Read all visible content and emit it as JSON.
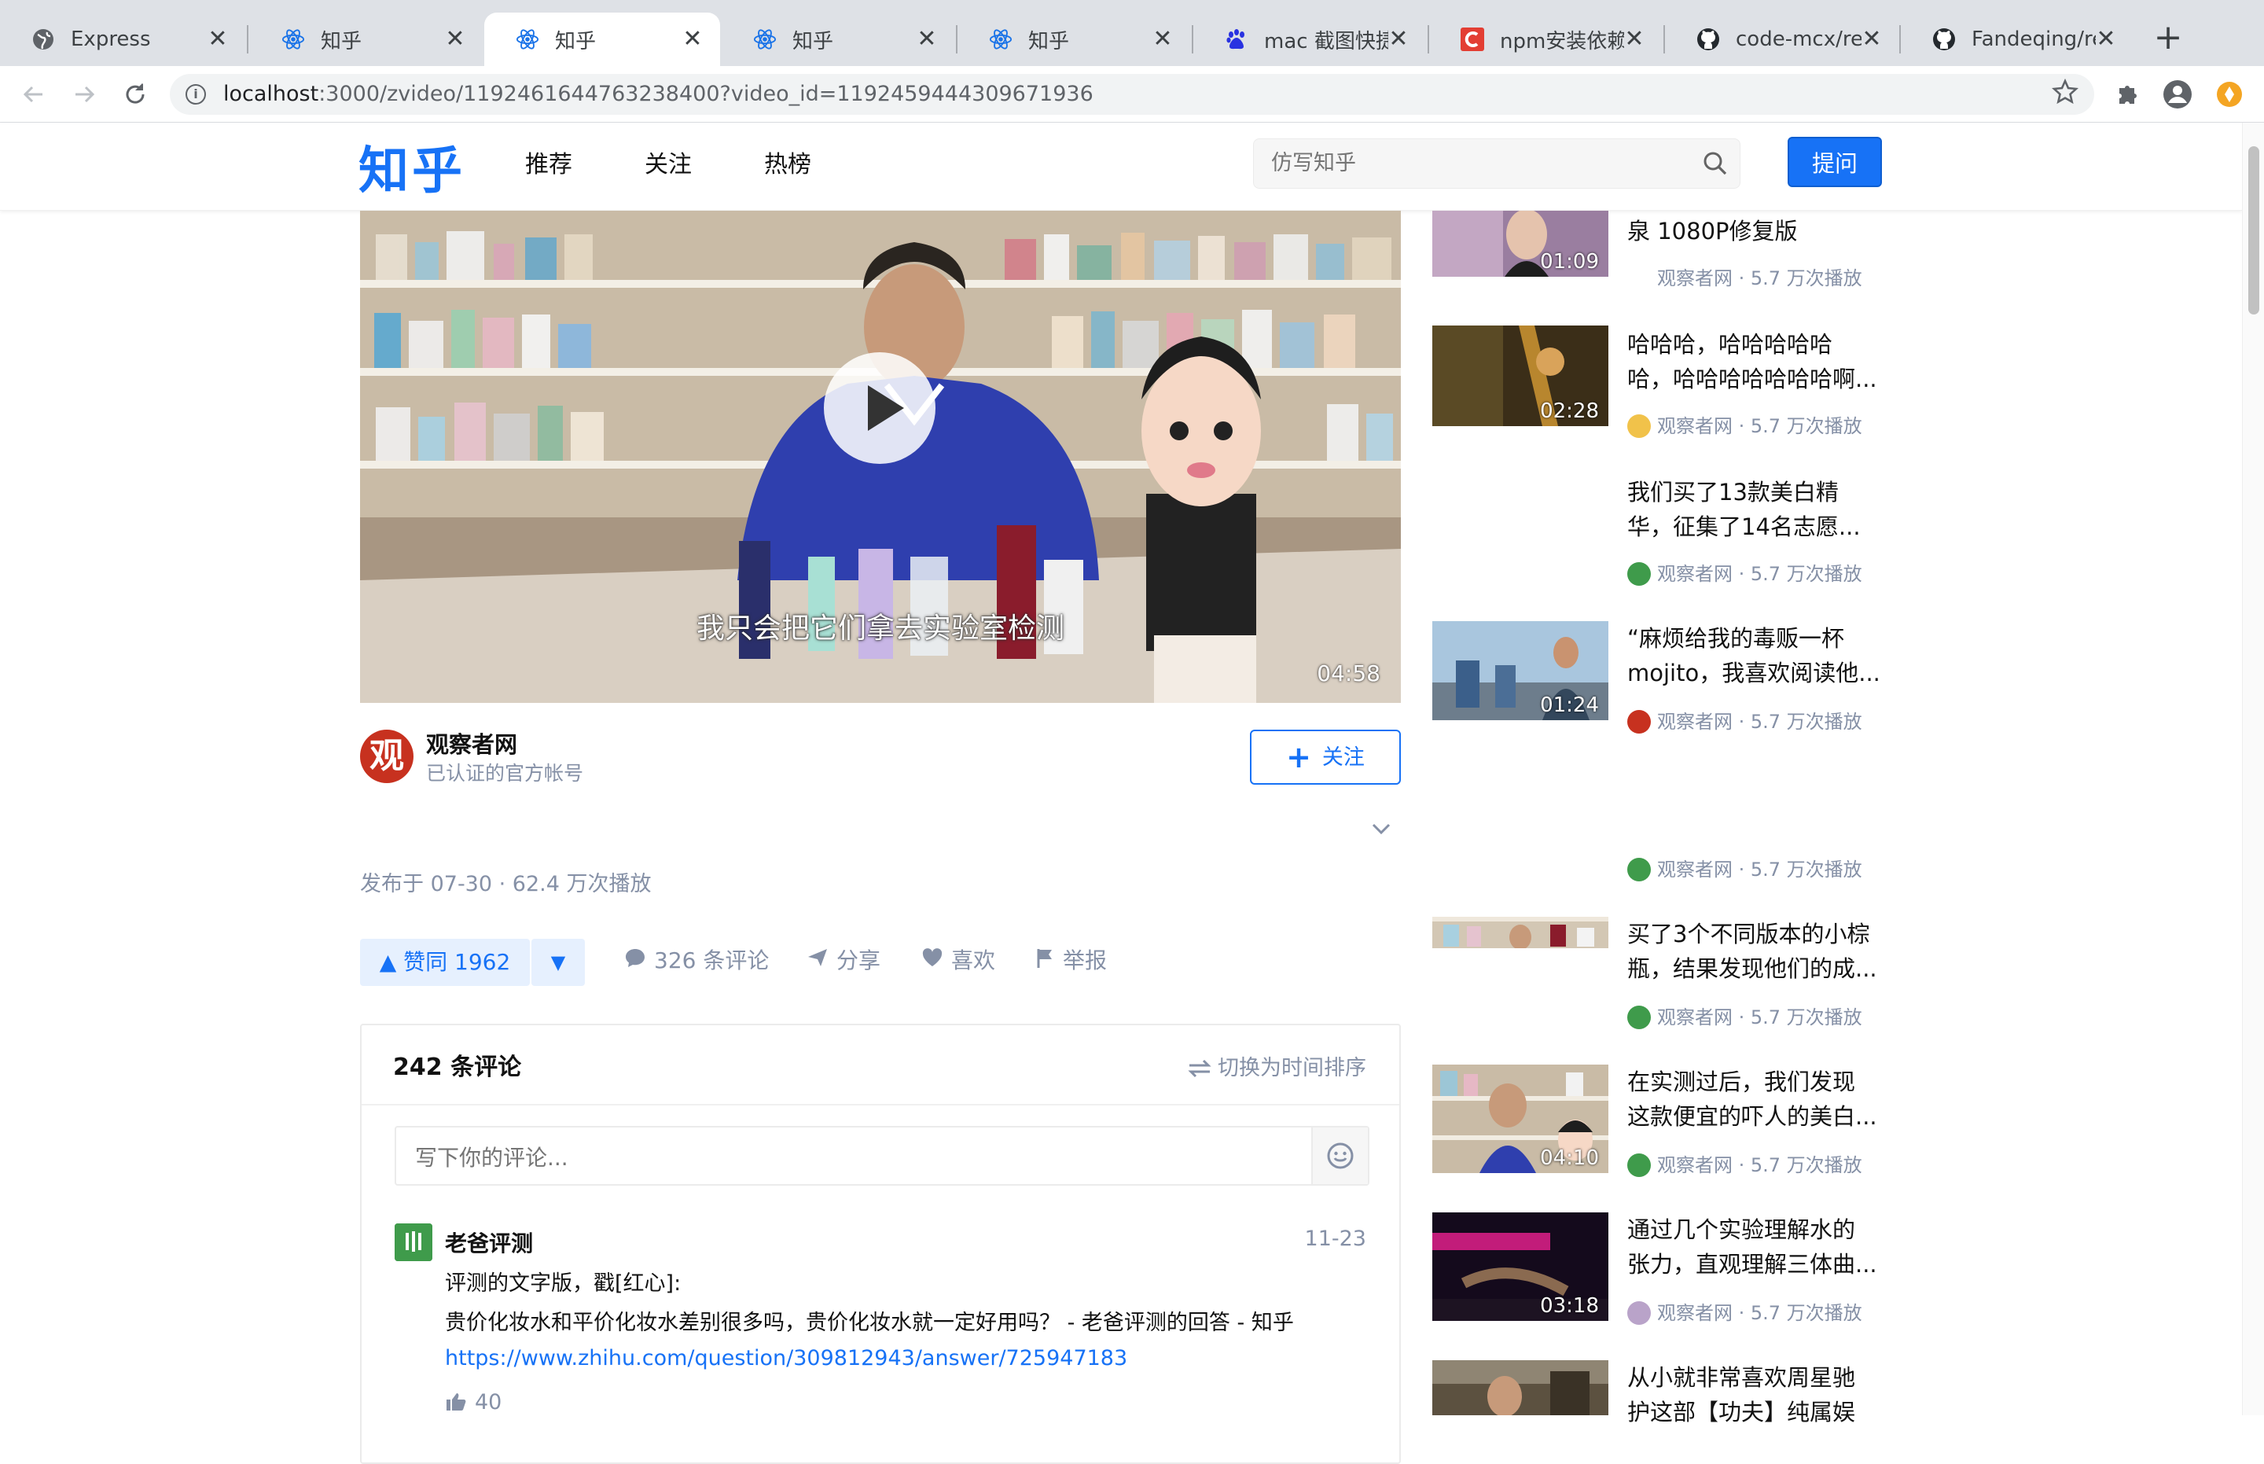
{
  "browser": {
    "tabs": [
      {
        "title": "Express",
        "icon": "globe-icon"
      },
      {
        "title": "知乎",
        "icon": "react-icon"
      },
      {
        "title": "知乎",
        "icon": "react-icon",
        "active": true
      },
      {
        "title": "知乎",
        "icon": "react-icon"
      },
      {
        "title": "知乎",
        "icon": "react-icon"
      },
      {
        "title": "mac 截图快捷键",
        "icon": "baidu-paw-icon"
      },
      {
        "title": "npm安装依赖报",
        "icon": "csdn-icon"
      },
      {
        "title": "code-mcx/reac",
        "icon": "github-icon"
      },
      {
        "title": "Fandeqing/reac",
        "icon": "github-icon"
      }
    ],
    "close_glyph": "✕",
    "new_tab_glyph": "+",
    "url_host": "localhost",
    "url_rest": ":3000/zvideo/1192461644763238400?video_id=1192459444309671936",
    "colors": {
      "brand": "#1772f6",
      "tabstrip": "#dee1e6"
    }
  },
  "header": {
    "logo": "知乎",
    "nav": [
      "推荐",
      "关注",
      "热榜"
    ],
    "search_placeholder": "仿写知乎",
    "ask_label": "提问"
  },
  "video": {
    "subtitle": "我只会把它们拿去实验室检测",
    "duration": "04:58"
  },
  "author": {
    "avatar_glyph": "观",
    "name": "观察者网",
    "sub": "已认证的官方帐号",
    "follow_label": "关注"
  },
  "publish": "发布于 07-30 · 62.4 万次播放",
  "actions": {
    "vote_up": "▲ 赞同 1962",
    "vote_down": "▼",
    "comment": "326 条评论",
    "share": "分享",
    "like": "喜欢",
    "report": "举报"
  },
  "comments": {
    "count_label": "242 条评论",
    "sort_label": "切换为时间排序",
    "input_placeholder": "写下你的评论...",
    "items": [
      {
        "name": "老爸评测",
        "date": "11-23",
        "line1": "评测的文字版，戳[红心]:",
        "line2": "贵价化妆水和平价化妆水差别很多吗，贵价化妆水就一定好用吗？ - 老爸评测的回答 - 知乎",
        "link": "https://www.zhihu.com/question/309812943/answer/725947183",
        "likes": "40"
      }
    ]
  },
  "related": [
    {
      "title1": "泉 1080P修复版",
      "title2": "",
      "meta": "观察者网 · 5.7 万次播放",
      "duration": "01:09",
      "avatar": "none"
    },
    {
      "title1": "哈哈哈，哈哈哈哈哈",
      "title2": "哈，哈哈哈哈哈哈哈啊...",
      "meta": "观察者网 · 5.7 万次播放",
      "duration": "02:28",
      "avatar": "cartoon"
    },
    {
      "title1": "我们买了13款美白精",
      "title2": "华，征集了14名志愿...",
      "meta": "观察者网 · 5.7 万次播放",
      "duration": "",
      "avatar": "green"
    },
    {
      "title1": "“麻烦给我的毒贩一杯",
      "title2": "mojito，我喜欢阅读他...",
      "meta": "观察者网 · 5.7 万次播放",
      "duration": "01:24",
      "avatar": "red"
    },
    {
      "title1": "",
      "title2": "",
      "meta": "观察者网 · 5.7 万次播放",
      "duration": "",
      "avatar": "green"
    },
    {
      "title1": "买了3个不同版本的小棕",
      "title2": "瓶，结果发现他们的成...",
      "meta": "观察者网 · 5.7 万次播放",
      "duration": "",
      "avatar": "green"
    },
    {
      "title1": "在实测过后，我们发现",
      "title2": "这款便宜的吓人的美白...",
      "meta": "观察者网 · 5.7 万次播放",
      "duration": "04:10",
      "avatar": "green"
    },
    {
      "title1": "通过几个实验理解水的",
      "title2": "张力，直观理解三体曲...",
      "meta": "观察者网 · 5.7 万次播放",
      "duration": "03:18",
      "avatar": "cartoon"
    },
    {
      "title1": "从小就非常喜欢周星驰",
      "title2": "护这部【功夫】纯属娱",
      "meta": "",
      "duration": "",
      "avatar": "none"
    }
  ]
}
